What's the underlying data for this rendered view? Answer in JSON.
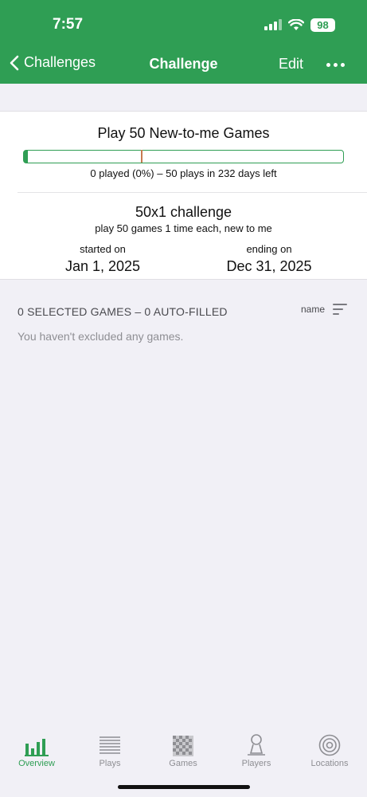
{
  "status_bar": {
    "time": "7:57",
    "battery": "98"
  },
  "nav": {
    "back_label": "Challenges",
    "title": "Challenge",
    "edit_label": "Edit"
  },
  "challenge": {
    "title": "Play 50 New-to-me Games",
    "progress_fraction": 0,
    "progress_text": "0 played (0%) – 50 plays in 232 days left",
    "subtitle": "50x1 challenge",
    "description": "play 50 games 1 time each, new to me",
    "start_label": "started on",
    "start_date": "Jan 1, 2025",
    "end_label": "ending on",
    "end_date": "Dec 31, 2025"
  },
  "games_section": {
    "header": "0 SELECTED GAMES – 0 AUTO-FILLED",
    "sort_label": "name",
    "empty_text": "You haven't excluded any games."
  },
  "tabbar": {
    "tabs": [
      {
        "label": "Overview",
        "icon": "bar-chart-icon",
        "active": true
      },
      {
        "label": "Plays",
        "icon": "list-icon",
        "active": false
      },
      {
        "label": "Games",
        "icon": "checkerboard-icon",
        "active": false
      },
      {
        "label": "Players",
        "icon": "pawn-icon",
        "active": false
      },
      {
        "label": "Locations",
        "icon": "target-icon",
        "active": false
      }
    ]
  },
  "colors": {
    "accent": "#2f9e54",
    "marker": "#c77a50",
    "background": "#f1f0f6"
  }
}
